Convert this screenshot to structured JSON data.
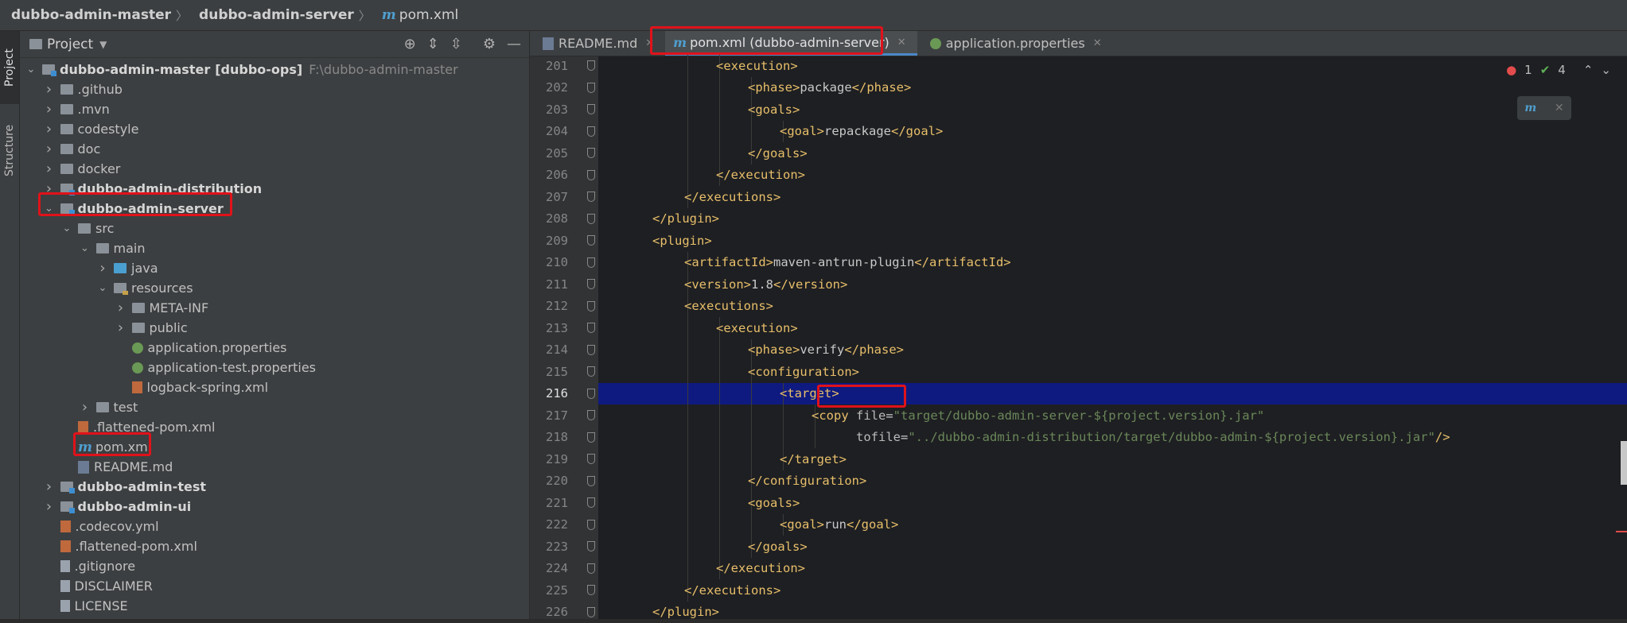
{
  "breadcrumb": {
    "items": [
      "dubbo-admin-master",
      "dubbo-admin-server",
      "pom.xml"
    ]
  },
  "side_tabs": [
    "Project",
    "Structure"
  ],
  "project_panel": {
    "title": "Project",
    "tree": [
      {
        "label": "dubbo-admin-master",
        "extra": "[dubbo-ops]",
        "path": "F:\\dubbo-admin-master",
        "level": 0,
        "expanded": true,
        "kind": "module"
      },
      {
        "label": ".github",
        "level": 1,
        "expanded": false,
        "kind": "folder"
      },
      {
        "label": ".mvn",
        "level": 1,
        "expanded": false,
        "kind": "folder"
      },
      {
        "label": "codestyle",
        "level": 1,
        "expanded": false,
        "kind": "folder"
      },
      {
        "label": "doc",
        "level": 1,
        "expanded": false,
        "kind": "folder"
      },
      {
        "label": "docker",
        "level": 1,
        "expanded": false,
        "kind": "folder"
      },
      {
        "label": "dubbo-admin-distribution",
        "level": 1,
        "expanded": false,
        "kind": "module"
      },
      {
        "label": "dubbo-admin-server",
        "level": 1,
        "expanded": true,
        "kind": "module"
      },
      {
        "label": "src",
        "level": 2,
        "expanded": true,
        "kind": "folder"
      },
      {
        "label": "main",
        "level": 3,
        "expanded": true,
        "kind": "folder"
      },
      {
        "label": "java",
        "level": 4,
        "expanded": false,
        "kind": "src-folder"
      },
      {
        "label": "resources",
        "level": 4,
        "expanded": true,
        "kind": "res-folder"
      },
      {
        "label": "META-INF",
        "level": 5,
        "expanded": false,
        "kind": "folder"
      },
      {
        "label": "public",
        "level": 5,
        "expanded": false,
        "kind": "folder"
      },
      {
        "label": "application.properties",
        "level": 5,
        "kind": "props"
      },
      {
        "label": "application-test.properties",
        "level": 5,
        "kind": "props"
      },
      {
        "label": "logback-spring.xml",
        "level": 5,
        "kind": "xml"
      },
      {
        "label": "test",
        "level": 3,
        "expanded": false,
        "kind": "folder"
      },
      {
        "label": ".flattened-pom.xml",
        "level": 2,
        "kind": "xml"
      },
      {
        "label": "pom.xml",
        "level": 2,
        "kind": "maven"
      },
      {
        "label": "README.md",
        "level": 2,
        "kind": "md"
      },
      {
        "label": "dubbo-admin-test",
        "level": 1,
        "expanded": false,
        "kind": "module"
      },
      {
        "label": "dubbo-admin-ui",
        "level": 1,
        "expanded": false,
        "kind": "module"
      },
      {
        "label": ".codecov.yml",
        "level": 1,
        "kind": "yml"
      },
      {
        "label": ".flattened-pom.xml",
        "level": 1,
        "kind": "xml"
      },
      {
        "label": ".gitignore",
        "level": 1,
        "kind": "txt"
      },
      {
        "label": "DISCLAIMER",
        "level": 1,
        "kind": "txt"
      },
      {
        "label": "LICENSE",
        "level": 1,
        "kind": "txt"
      }
    ]
  },
  "editor_tabs": [
    {
      "label": "README.md",
      "active": false
    },
    {
      "label": "pom.xml (dubbo-admin-server)",
      "active": true
    },
    {
      "label": "application.properties",
      "active": false
    }
  ],
  "status": {
    "errors": "1",
    "checks": "4"
  },
  "code_lines": [
    {
      "n": "201",
      "indent": 5,
      "parts": [
        [
          "tag",
          "<execution>"
        ]
      ]
    },
    {
      "n": "202",
      "indent": 6,
      "parts": [
        [
          "tag",
          "<phase>"
        ],
        [
          "txt",
          "package"
        ],
        [
          "tag",
          "</phase>"
        ]
      ]
    },
    {
      "n": "203",
      "indent": 6,
      "parts": [
        [
          "tag",
          "<goals>"
        ]
      ]
    },
    {
      "n": "204",
      "indent": 7,
      "parts": [
        [
          "tag",
          "<goal>"
        ],
        [
          "txt",
          "repackage"
        ],
        [
          "tag",
          "</goal>"
        ]
      ]
    },
    {
      "n": "205",
      "indent": 6,
      "parts": [
        [
          "tag",
          "</goals>"
        ]
      ]
    },
    {
      "n": "206",
      "indent": 5,
      "parts": [
        [
          "tag",
          "</execution>"
        ]
      ]
    },
    {
      "n": "207",
      "indent": 4,
      "parts": [
        [
          "tag",
          "</executions>"
        ]
      ]
    },
    {
      "n": "208",
      "indent": 3,
      "parts": [
        [
          "tag",
          "</plugin>"
        ]
      ]
    },
    {
      "n": "209",
      "indent": 3,
      "parts": [
        [
          "tag",
          "<plugin>"
        ]
      ]
    },
    {
      "n": "210",
      "indent": 4,
      "parts": [
        [
          "tag",
          "<artifactId>"
        ],
        [
          "txt",
          "maven-antrun-plugin"
        ],
        [
          "tag",
          "</artifactId>"
        ]
      ]
    },
    {
      "n": "211",
      "indent": 4,
      "parts": [
        [
          "tag",
          "<version>"
        ],
        [
          "txt",
          "1.8"
        ],
        [
          "tag",
          "</version>"
        ]
      ]
    },
    {
      "n": "212",
      "indent": 4,
      "parts": [
        [
          "tag",
          "<executions>"
        ]
      ]
    },
    {
      "n": "213",
      "indent": 5,
      "parts": [
        [
          "tag",
          "<execution>"
        ]
      ]
    },
    {
      "n": "214",
      "indent": 6,
      "parts": [
        [
          "tag",
          "<phase>"
        ],
        [
          "txt",
          "verify"
        ],
        [
          "tag",
          "</phase>"
        ]
      ]
    },
    {
      "n": "215",
      "indent": 6,
      "parts": [
        [
          "tag",
          "<configuration>"
        ]
      ]
    },
    {
      "n": "216",
      "indent": 7,
      "parts": [
        [
          "tag",
          "<target>"
        ]
      ],
      "selected": true
    },
    {
      "n": "217",
      "indent": 8,
      "parts": [
        [
          "tag",
          "<copy "
        ],
        [
          "attr",
          "file"
        ],
        [
          "txt",
          "="
        ],
        [
          "str",
          "\"target/dubbo-admin-server-${project.version}.jar\""
        ]
      ]
    },
    {
      "n": "218",
      "indent": 8,
      "parts": [
        [
          "txt",
          "      "
        ],
        [
          "attr",
          "tofile"
        ],
        [
          "txt",
          "="
        ],
        [
          "str",
          "\"../dubbo-admin-distribution/target/dubbo-admin-${project.version}.jar\""
        ],
        [
          "tag",
          "/>"
        ]
      ]
    },
    {
      "n": "219",
      "indent": 7,
      "parts": [
        [
          "tag",
          "</target>"
        ]
      ]
    },
    {
      "n": "220",
      "indent": 6,
      "parts": [
        [
          "tag",
          "</configuration>"
        ]
      ]
    },
    {
      "n": "221",
      "indent": 6,
      "parts": [
        [
          "tag",
          "<goals>"
        ]
      ]
    },
    {
      "n": "222",
      "indent": 7,
      "parts": [
        [
          "tag",
          "<goal>"
        ],
        [
          "txt",
          "run"
        ],
        [
          "tag",
          "</goal>"
        ]
      ]
    },
    {
      "n": "223",
      "indent": 6,
      "parts": [
        [
          "tag",
          "</goals>"
        ]
      ]
    },
    {
      "n": "224",
      "indent": 5,
      "parts": [
        [
          "tag",
          "</execution>"
        ]
      ]
    },
    {
      "n": "225",
      "indent": 4,
      "parts": [
        [
          "tag",
          "</executions>"
        ]
      ]
    },
    {
      "n": "226",
      "indent": 3,
      "parts": [
        [
          "tag",
          "</plugin>"
        ]
      ]
    }
  ]
}
